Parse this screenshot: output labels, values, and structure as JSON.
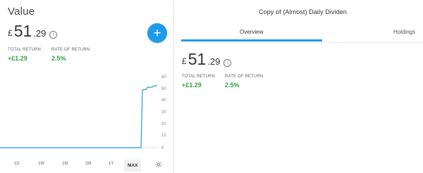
{
  "left_panel": {
    "title": "Value",
    "value": {
      "currency": "£",
      "integer": "51",
      "decimal": ".29"
    },
    "metrics": [
      {
        "label": "TOTAL RETURN",
        "value": "+£1.29"
      },
      {
        "label": "RATE OF RETURN",
        "value": "2.5%"
      }
    ],
    "chart": {
      "y_ticks": [
        "60",
        "50",
        "40",
        "30",
        "20",
        "10",
        "0"
      ]
    },
    "range_options": [
      "1D",
      "1W",
      "1M",
      "3M",
      "1Y",
      "MAX"
    ],
    "active_range": "MAX"
  },
  "right_panel": {
    "portfolio_title": "Copy of (Almost) Daily Dividen",
    "tabs": [
      {
        "label": "Overview",
        "active": true
      },
      {
        "label": "Holdings",
        "active": false
      }
    ],
    "value": {
      "currency": "£",
      "integer": "51",
      "decimal": ".29"
    },
    "metrics": [
      {
        "label": "TOTAL RETURN",
        "value": "+£1.29"
      },
      {
        "label": "RATE OF RETURN",
        "value": "2.5%"
      }
    ]
  },
  "colors": {
    "accent": "#1e9bea",
    "positive": "#2fa044",
    "text": "#333333",
    "muted": "#666666"
  }
}
